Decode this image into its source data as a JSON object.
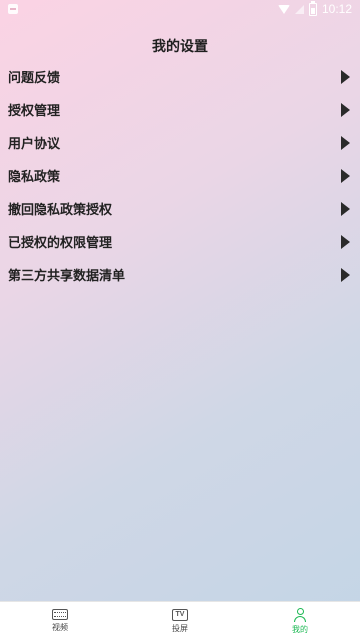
{
  "status_bar": {
    "time": "10:12",
    "icons": [
      "notification-icon",
      "wifi-icon",
      "signal-icon",
      "battery-icon"
    ]
  },
  "header": {
    "title": "我的设置"
  },
  "settings": {
    "items": [
      {
        "label": "问题反馈",
        "icon": "chevron-right-icon"
      },
      {
        "label": "授权管理",
        "icon": "chevron-right-icon"
      },
      {
        "label": "用户协议",
        "icon": "chevron-right-icon"
      },
      {
        "label": "隐私政策",
        "icon": "chevron-right-icon"
      },
      {
        "label": "撤回隐私政策授权",
        "icon": "chevron-right-icon"
      },
      {
        "label": "已授权的权限管理",
        "icon": "chevron-right-icon"
      },
      {
        "label": "第三方共享数据清单",
        "icon": "chevron-right-icon"
      }
    ]
  },
  "bottom_nav": {
    "items": [
      {
        "label": "视频",
        "icon": "film-icon",
        "active": false
      },
      {
        "label": "投屏",
        "icon": "tv-icon",
        "active": false
      },
      {
        "label": "我的",
        "icon": "user-icon",
        "active": true
      }
    ]
  },
  "colors": {
    "active_tab": "#1db954",
    "gradient_start": "#fbd3e4",
    "gradient_end": "#c3d5e6"
  }
}
